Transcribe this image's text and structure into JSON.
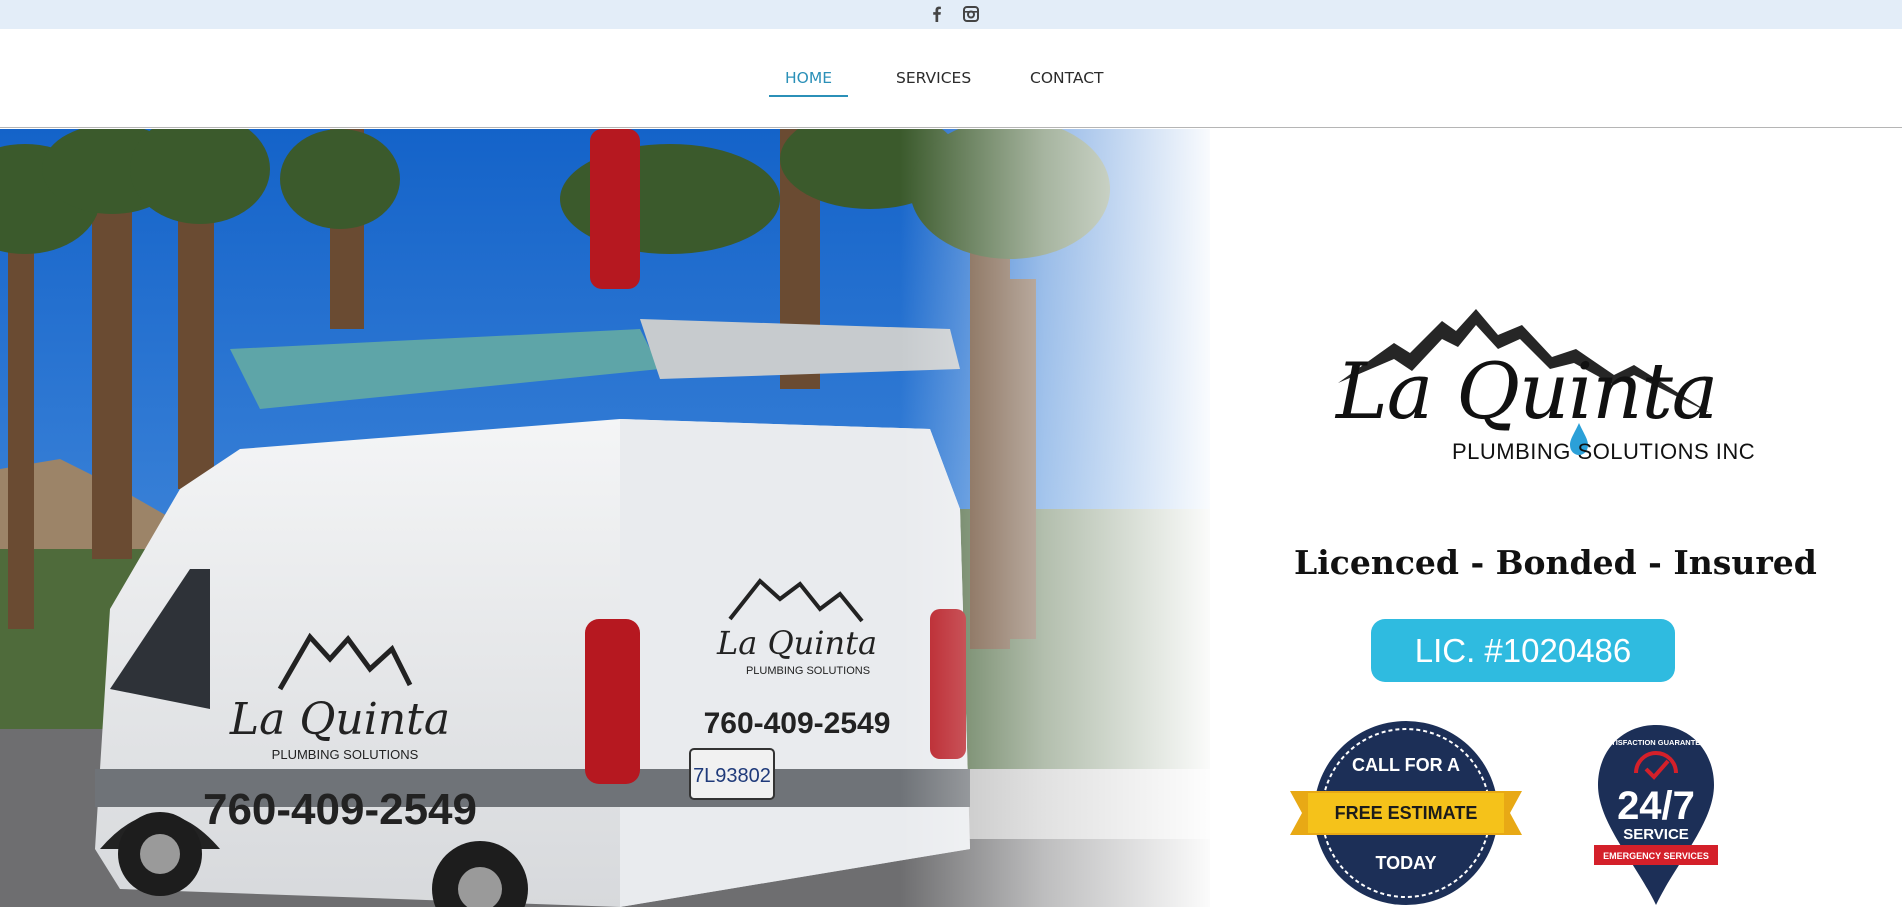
{
  "social": {
    "facebook_icon": "facebook-icon",
    "instagram_icon": "instagram-icon"
  },
  "nav": {
    "items": [
      {
        "label": "HOME",
        "active": true
      },
      {
        "label": "SERVICES",
        "active": false
      },
      {
        "label": "CONTACT",
        "active": false
      }
    ]
  },
  "hero": {
    "photo": {
      "van_logo_word": "La Quinta",
      "van_logo_sub": "PLUMBING SOLUTIONS",
      "van_phone": "760-409-2549",
      "plate": "7L93802"
    },
    "logo": {
      "word": "La Quinta",
      "sub": "PLUMBING SOLUTIONS  INC"
    },
    "tagline": "Licenced - Bonded - Insured",
    "license": "LIC. #1020486",
    "badge_estimate": {
      "top": "CALL FOR A",
      "band": "FREE ESTIMATE",
      "bottom": "TODAY"
    },
    "badge_247": {
      "arc": "SATISFACTION GUARANTEED",
      "big": "24/7",
      "service": "SERVICE",
      "ribbon": "EMERGENCY SERVICES"
    }
  },
  "colors": {
    "topbar": "#e3edf8",
    "accent": "#2b90b8",
    "license_bg": "#2fbbe0",
    "badge_navy": "#1c2f57",
    "badge_gold": "#f5c21a",
    "badge_red": "#d4202a"
  }
}
